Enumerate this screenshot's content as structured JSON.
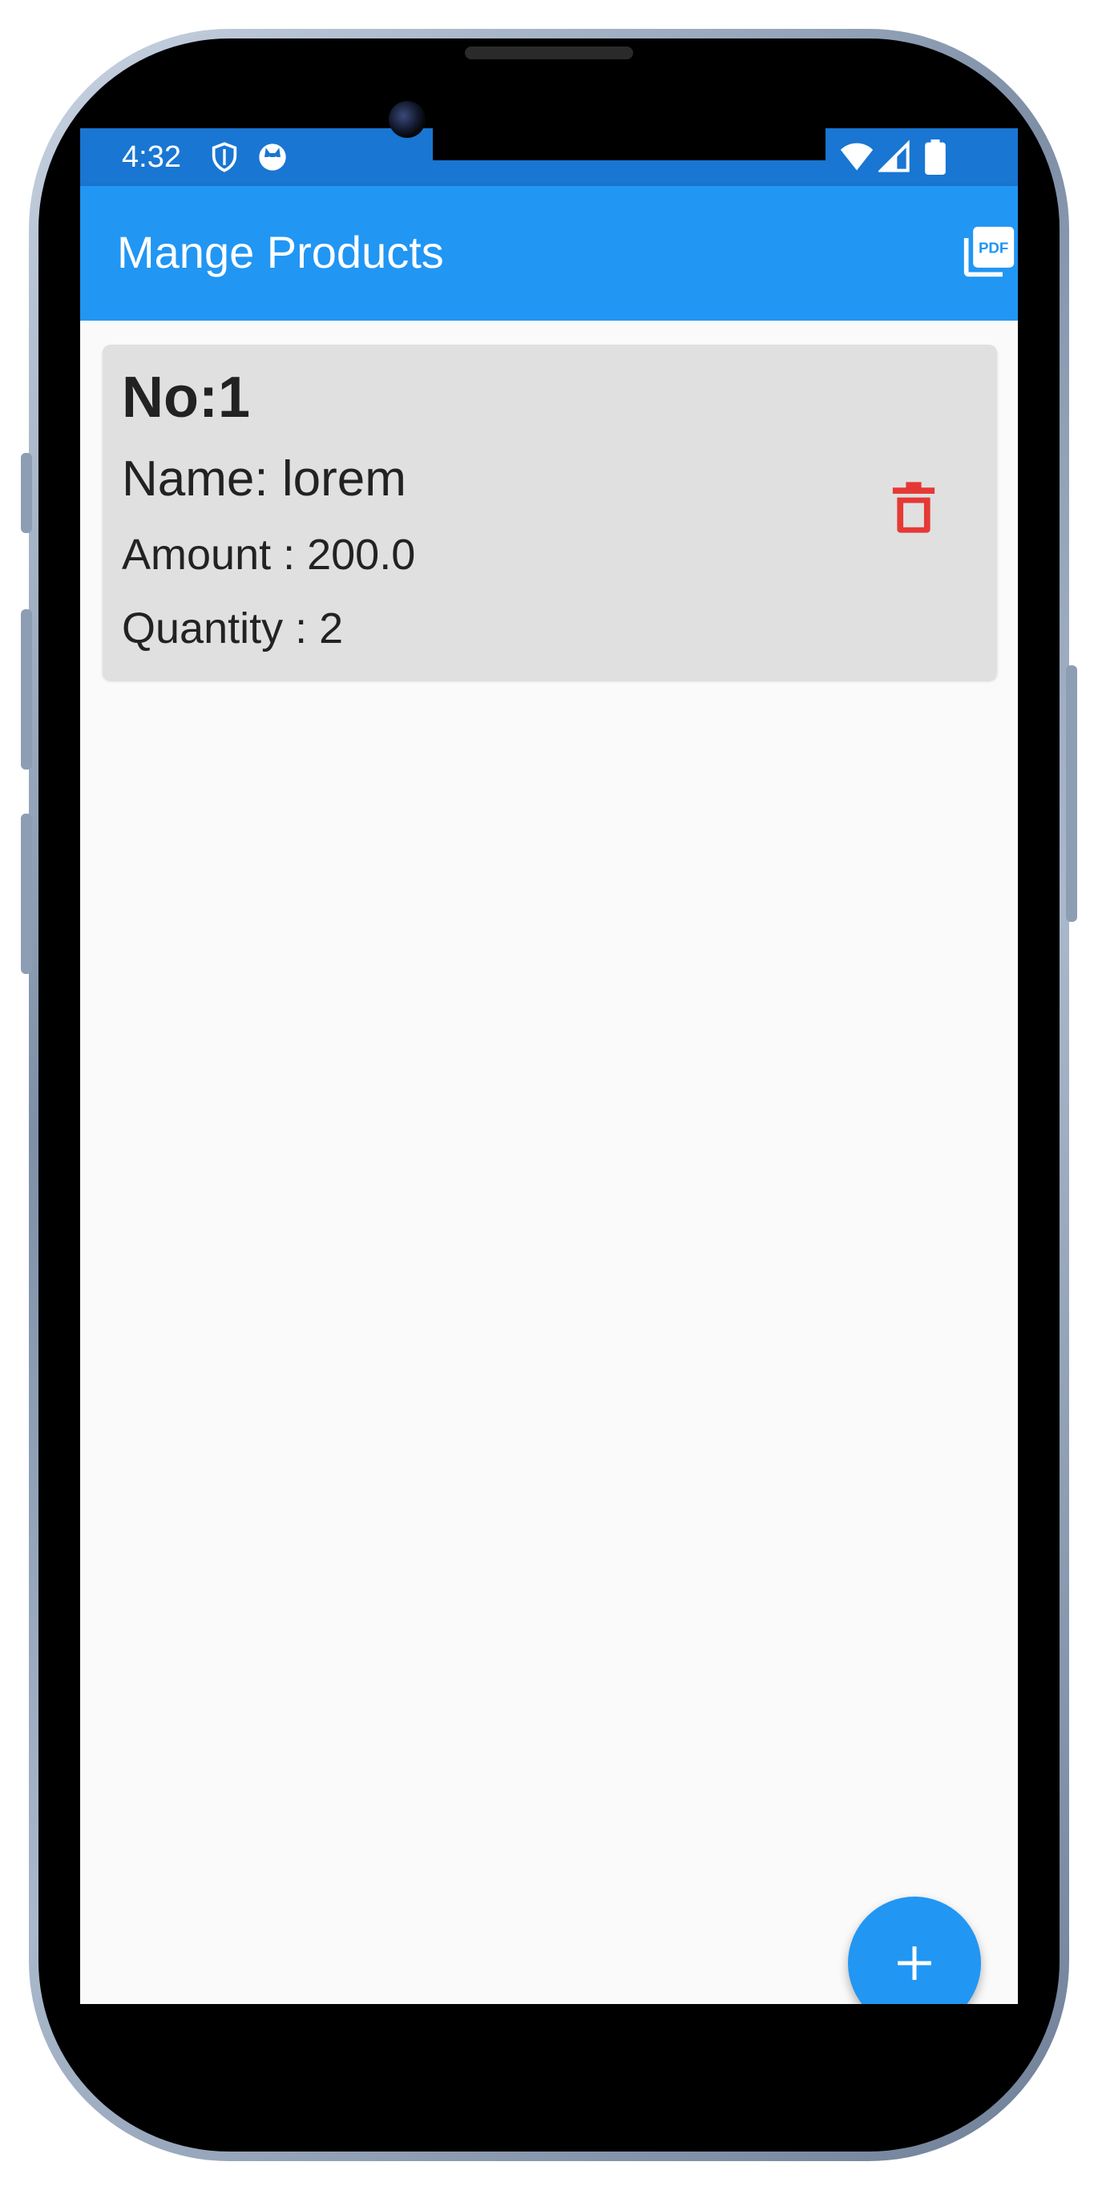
{
  "status_bar": {
    "time": "4:32",
    "left_icons": [
      "shield-icon",
      "cat-face-icon"
    ],
    "right_icons": [
      "wifi-icon",
      "cellular-signal-icon",
      "battery-icon"
    ],
    "color": "#1976d2"
  },
  "app_bar": {
    "title": "Mange Products",
    "action_icon": "picture-as-pdf-icon",
    "color": "#2196f3"
  },
  "products": [
    {
      "no_label": "No:1",
      "name_label": "Name: lorem",
      "amount_label": "Amount : 200.0",
      "quantity_label": "Quantity : 2",
      "delete_icon": "delete-outline-icon",
      "delete_color": "#e53935"
    }
  ],
  "fab": {
    "icon": "add-icon",
    "color": "#2196f3"
  }
}
